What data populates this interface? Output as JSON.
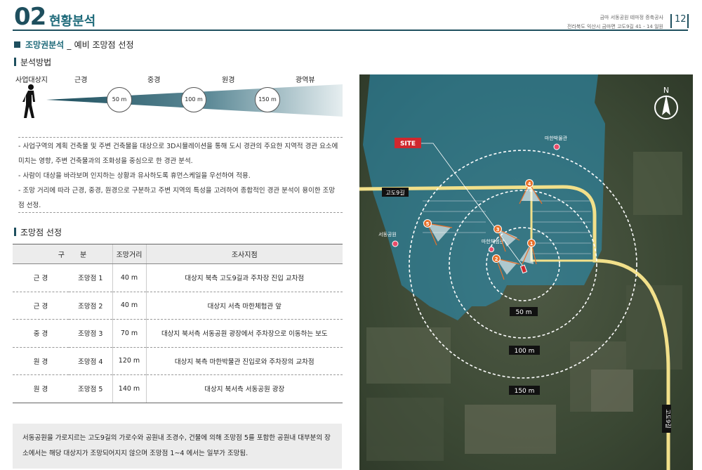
{
  "header": {
    "chapter_number": "02",
    "chapter_title": "현황분석",
    "project_line1": "금마 서동공원 테마정 증축공사",
    "project_line2": "전라북도 익산시 금마면 고도9길 41 - 14 일원",
    "page_number": "12"
  },
  "section": {
    "title": "조망권분석",
    "separator": "_",
    "subtitle": "예비 조망점 선정"
  },
  "method": {
    "heading": "분석방법",
    "labels": [
      "사업대상지",
      "근경",
      "중경",
      "원경",
      "광역뷰"
    ],
    "distances": [
      "50 m",
      "100 m",
      "150 m"
    ],
    "bullets": [
      "- 사업구역의 계획 건축물 및 주변 건축물을 대상으로 3D시뮬레이션을 통해 도시 경관의 주요한 지역적 경관 요소에",
      "미치는 영향, 주변 건축물과의 조화성을 중심으로 한 경관 분석.",
      "- 사람이 대상을 바라보며 인지하는 상황과 유사하도록 휴먼스케일을 우선하여 적용.",
      "- 조망 거리에 따라 근경, 중경, 원경으로 구분하고 주변 지역의 특성을 고려하여 종합적인 경관 분석이 용이한 조망",
      "점 선정."
    ]
  },
  "viewpoints": {
    "heading": "조망점 선정",
    "columns": [
      "구",
      "분",
      "조망거리",
      "조사지점"
    ],
    "rows": [
      {
        "type": "근 경",
        "name": "조망점 1",
        "distance": "40 m",
        "location": "대상지 북측 고도9길과 주차장 진입 교차점"
      },
      {
        "type": "근 경",
        "name": "조망점 2",
        "distance": "40 m",
        "location": "대상지 서측 마한체험관 앞"
      },
      {
        "type": "중 경",
        "name": "조망점 3",
        "distance": "70 m",
        "location": "대상지 북서측 서동공원 광장에서 주차장으로 이동하는 보도"
      },
      {
        "type": "원 경",
        "name": "조망점 4",
        "distance": "120 m",
        "location": "대상지 북측 마한박물관 진입로와 주차장의 교차점"
      },
      {
        "type": "원 경",
        "name": "조망점 5",
        "distance": "140 m",
        "location": "대상지 북서측 서동공원 광장"
      }
    ]
  },
  "note": {
    "line1": "서동공원을 가로지르는 고도9길의 가로수와 공원내 조경수, 건물에 의해 조망점 5를 포함한 공원내 대부분의 장",
    "line2": "소에서는 해당 대상지가 조망되어지지 않으며 조망점 1~4 에서는 일부가 조망됨."
  },
  "map": {
    "site_label": "SITE",
    "north_label": "N",
    "road_label": "고도9길",
    "road_label_vertical": "고도9길",
    "places": [
      "마한박물관",
      "서동공원",
      "마한체험관"
    ],
    "radius_labels": [
      "50 m",
      "100 m",
      "150 m"
    ],
    "viewpoint_numbers": [
      "1",
      "2",
      "3",
      "4",
      "5"
    ],
    "colors": {
      "water_overlay": "#2a8fb5",
      "road": "#f2e08a",
      "marker": "#e8702a",
      "site": "#d0282e"
    }
  }
}
